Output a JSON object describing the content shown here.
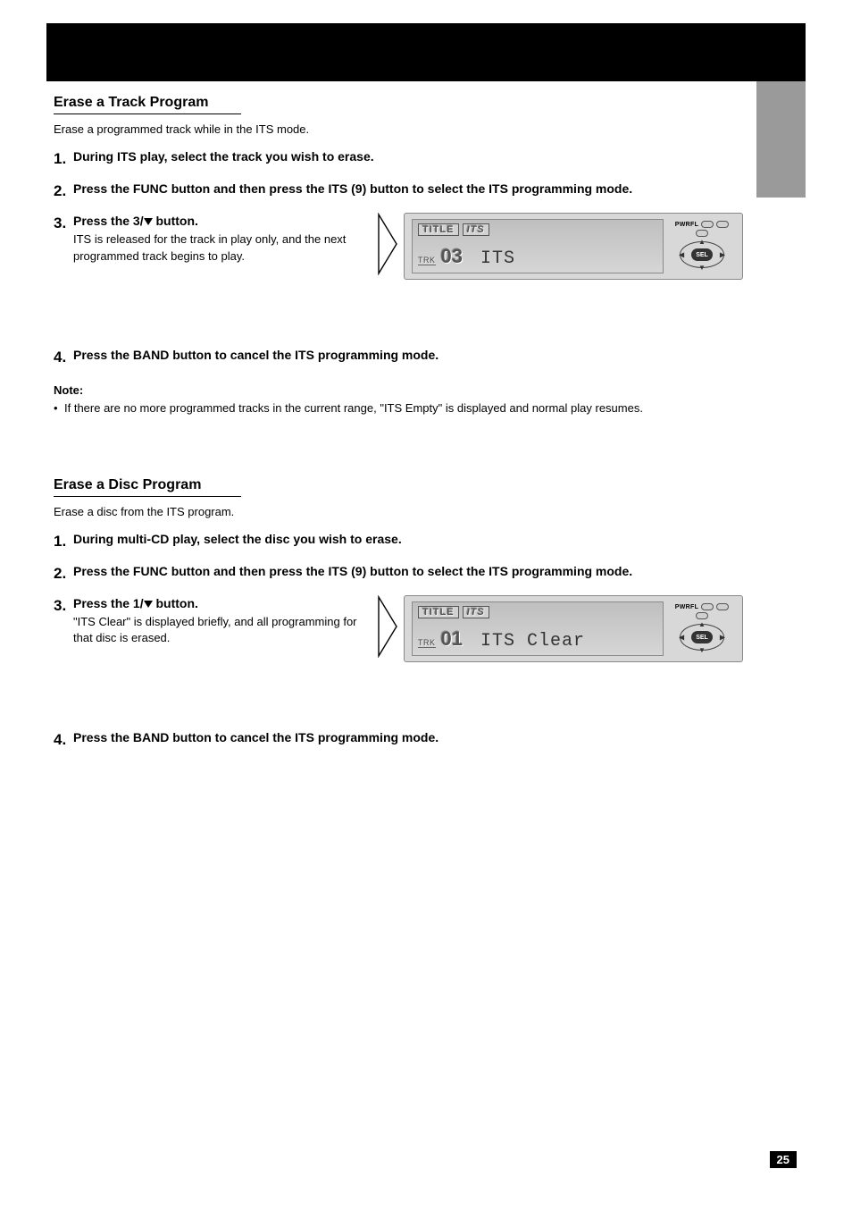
{
  "sections": [
    {
      "title": "Erase a Track Program",
      "intro": "Erase a programmed track while in the ITS mode.",
      "steps": [
        {
          "num": "1.",
          "main": "During ITS play, select the track you wish to erase."
        },
        {
          "num": "2.",
          "main": "Press the FUNC button and then press the ITS (9) button to select the ITS programming mode."
        },
        {
          "num": "3.",
          "main_prefix": "Press the 3/",
          "main_suffix": " button.",
          "sub": "ITS is released for the track in play only, and the next programmed track begins to play."
        },
        {
          "num": "4.",
          "main": "Press the BAND button to cancel the ITS programming mode."
        }
      ],
      "note": {
        "label": "Note:",
        "items": [
          "If there are no more programmed tracks in the current range, \"ITS Empty\" is displayed and normal play resumes."
        ]
      },
      "lcd": {
        "title_tab": "TITLE",
        "its_tab": "ITS",
        "trk_label": "TRK",
        "trk_num": "03",
        "main_text": "ITS",
        "pwrfl": "PWRFL",
        "sel": "SEL"
      }
    },
    {
      "title": "Erase a Disc Program",
      "intro": "Erase a disc from the ITS program.",
      "steps": [
        {
          "num": "1.",
          "main": "During multi-CD play, select the disc you wish to erase."
        },
        {
          "num": "2.",
          "main": "Press the FUNC button and then press the ITS (9) button to select the ITS programming mode."
        },
        {
          "num": "3.",
          "main_prefix": "Press the 1/",
          "main_suffix": " button.",
          "sub": "\"ITS Clear\" is displayed briefly, and all programming for that disc is erased."
        },
        {
          "num": "4.",
          "main": "Press the BAND button to cancel the ITS programming mode."
        }
      ],
      "lcd": {
        "title_tab": "TITLE",
        "its_tab": "ITS",
        "trk_label": "TRK",
        "trk_num": "01",
        "main_text": "ITS Clear",
        "pwrfl": "PWRFL",
        "sel": "SEL"
      }
    }
  ],
  "page_number": "25"
}
